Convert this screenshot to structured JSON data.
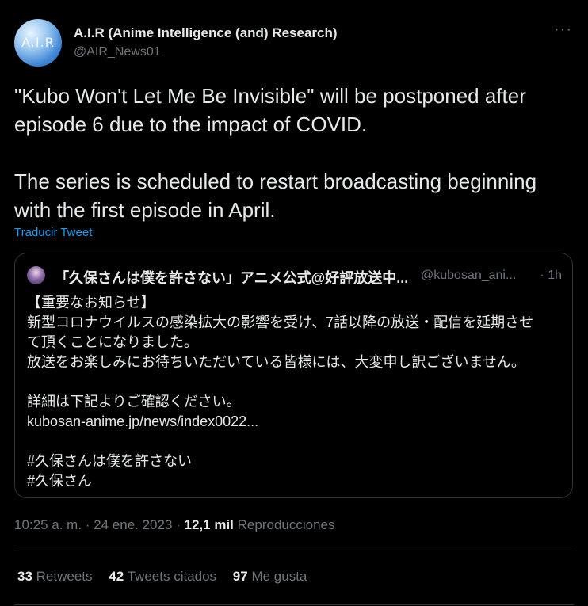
{
  "author": {
    "avatar_text": "A.I.R",
    "name": "A.I.R (Anime Intelligence (and) Research)",
    "handle": "@AIR_News01"
  },
  "more_label": "···",
  "tweet_text": "\"Kubo Won't Let Me Be Invisible\" will be postponed after episode 6 due to the impact of COVID.\n\nThe series is scheduled to restart broadcasting beginning with the first episode in April.",
  "translate_label": "Traducir Tweet",
  "quoted": {
    "name": "「久保さんは僕を許さない」アニメ公式@好評放送中...",
    "handle": "@kubosan_ani...",
    "time": "· 1h",
    "lines": [
      "【重要なお知らせ】",
      "新型コロナウイルスの感染拡大の影響を受け、7話以降の放送・配信を延期させ",
      "て頂くことになりました。",
      "放送をお楽しみにお待ちいただいている皆様には、大変申し訳ございません。",
      "",
      "詳細は下記よりご確認ください。",
      "kubosan-anime.jp/news/index0022...",
      "",
      "#久保さんは僕を許さない",
      "#久保さん"
    ]
  },
  "meta": {
    "timestamp": "10:25 a. m. · 24 ene. 2023 · ",
    "views_count": "12,1 mil",
    "views_label": "Reproducciones"
  },
  "stats": {
    "retweets_count": "33",
    "retweets_label": "Retweets",
    "quotes_count": "42",
    "quotes_label": "Tweets citados",
    "likes_count": "97",
    "likes_label": "Me gusta"
  },
  "colors": {
    "background": "#000000",
    "text": "#e7e9ea",
    "secondary": "#71767b",
    "link": "#1d9bf0",
    "border": "#2f3336"
  }
}
